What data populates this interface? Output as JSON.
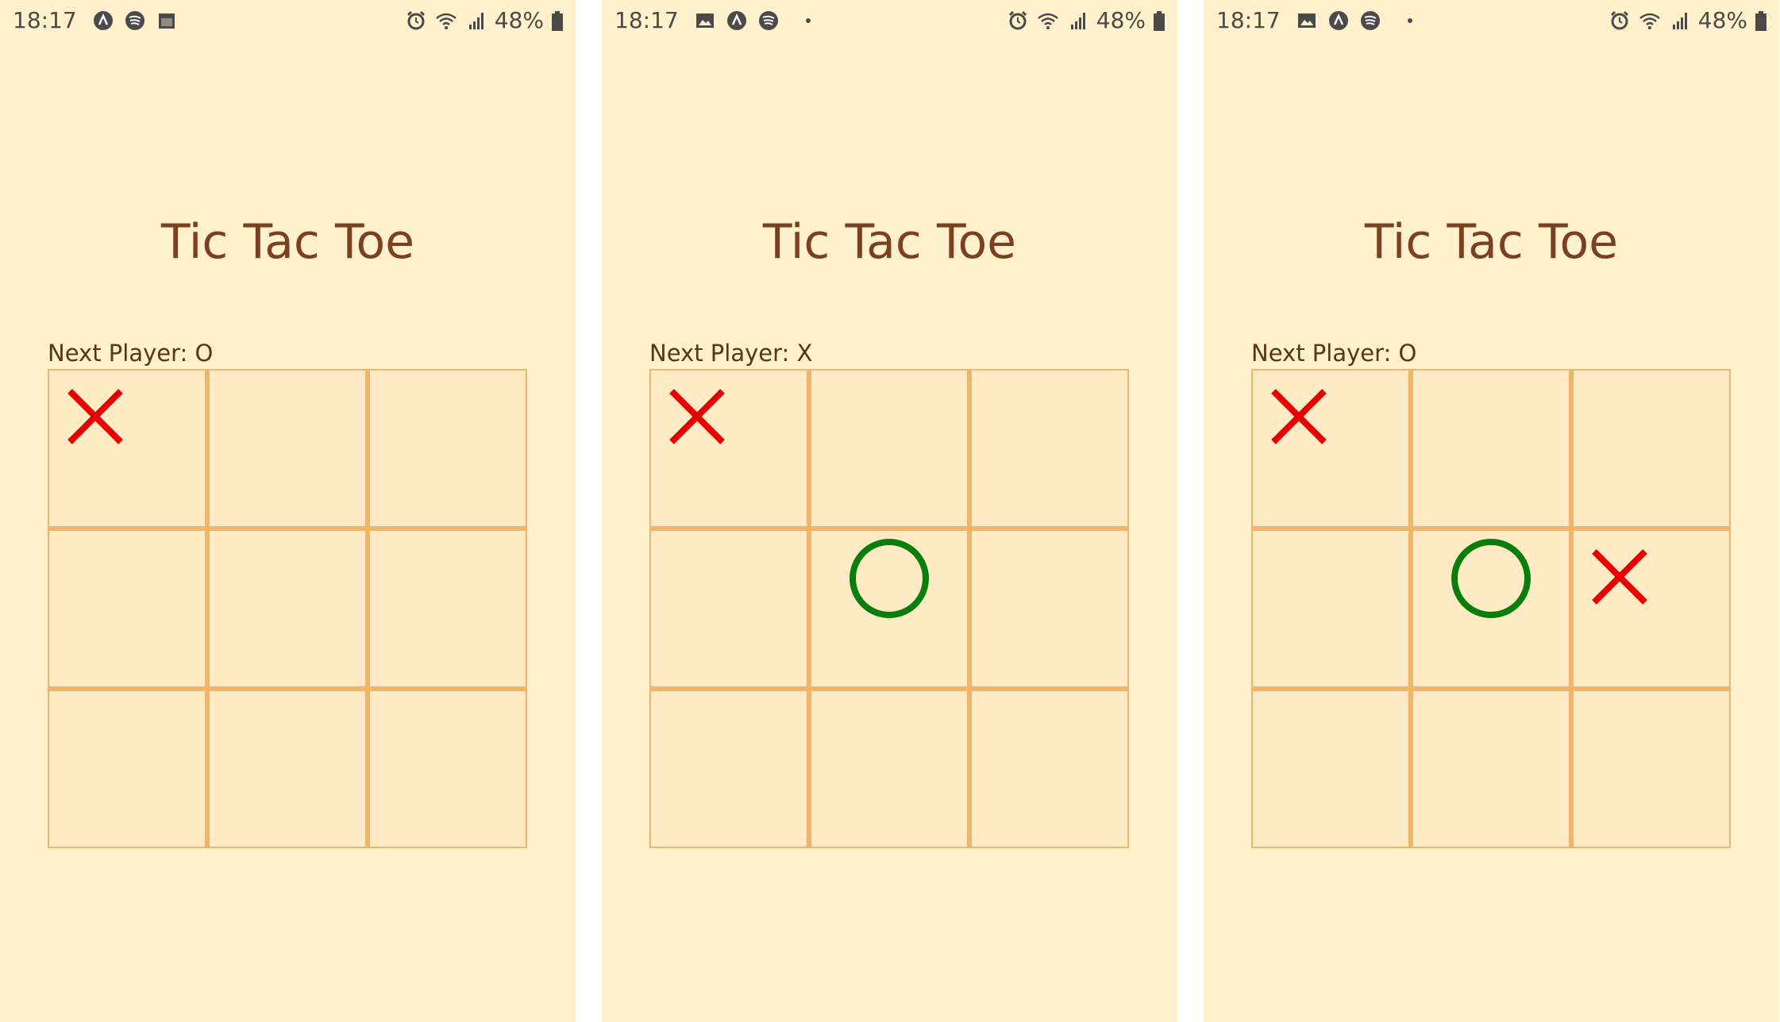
{
  "colors": {
    "background": "#fef1cc",
    "cell": "#feeac5",
    "grid": "#f0b46a",
    "title": "#7c3f1f",
    "x_mark": "#e60000",
    "o_mark": "#0a7e0a"
  },
  "screens": [
    {
      "status": {
        "time": "18:17",
        "battery": "48%",
        "left_icons": [
          "app-a-icon",
          "spotify-icon",
          "calendar-icon"
        ]
      },
      "title": "Tic Tac Toe",
      "next_player": "Next Player: O",
      "board": [
        "X",
        "",
        "",
        "",
        "",
        "",
        "",
        "",
        ""
      ]
    },
    {
      "status": {
        "time": "18:17",
        "battery": "48%",
        "left_icons": [
          "gallery-icon",
          "app-a-icon",
          "spotify-icon",
          "dot"
        ]
      },
      "title": "Tic Tac Toe",
      "next_player": "Next Player: X",
      "board": [
        "X",
        "",
        "",
        "",
        "O",
        "",
        "",
        "",
        ""
      ]
    },
    {
      "status": {
        "time": "18:17",
        "battery": "48%",
        "left_icons": [
          "gallery-icon",
          "app-a-icon",
          "spotify-icon",
          "dot"
        ]
      },
      "title": "Tic Tac Toe",
      "next_player": "Next Player: O",
      "board": [
        "X",
        "",
        "",
        "",
        "O",
        "X",
        "",
        "",
        ""
      ]
    }
  ]
}
